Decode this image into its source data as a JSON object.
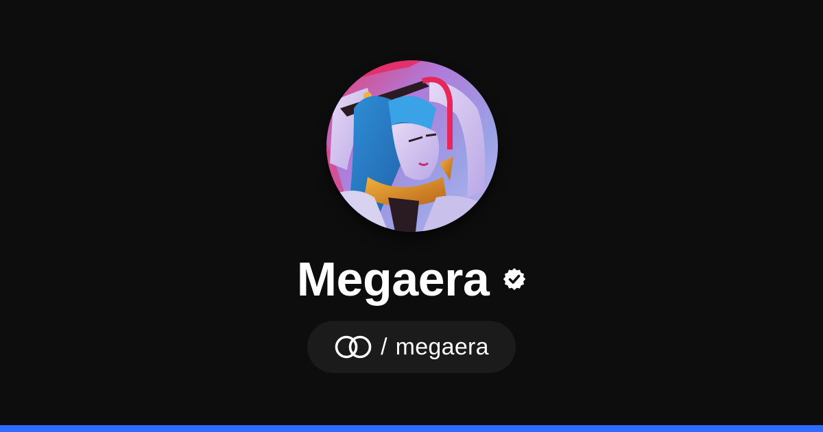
{
  "profile": {
    "display_name": "Megaera",
    "verified": true,
    "handle_separator": "/",
    "handle": "megaera",
    "avatar_alt": "Megaera"
  },
  "icons": {
    "verified": "verified-check-icon",
    "platform_logo": "linked-rings-logo-icon"
  },
  "colors": {
    "background": "#0d0d0d",
    "pill_background": "#1b1b1b",
    "text": "#ffffff",
    "accent_bar": "#2f6bff"
  }
}
